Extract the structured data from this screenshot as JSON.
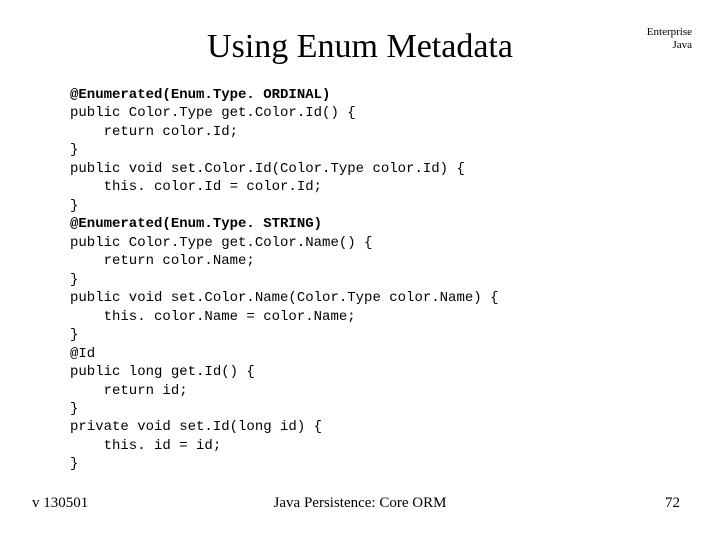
{
  "title": "Using Enum Metadata",
  "corner": {
    "line1": "Enterprise",
    "line2": "Java"
  },
  "code": {
    "l1": "@Enumerated(Enum.Type. ORDINAL)",
    "l2": "public Color.Type get.Color.Id() {",
    "l3": "    return color.Id;",
    "l4": "}",
    "l5": "public void set.Color.Id(Color.Type color.Id) {",
    "l6": "    this. color.Id = color.Id;",
    "l7": "}",
    "l8": "@Enumerated(Enum.Type. STRING)",
    "l9": "public Color.Type get.Color.Name() {",
    "l10": "    return color.Name;",
    "l11": "}",
    "l12": "public void set.Color.Name(Color.Type color.Name) {",
    "l13": "    this. color.Name = color.Name;",
    "l14": "}",
    "l15": "@Id",
    "l16": "public long get.Id() {",
    "l17": "    return id;",
    "l18": "}",
    "l19": "private void set.Id(long id) {",
    "l20": "    this. id = id;",
    "l21": "}"
  },
  "footer": {
    "left": "v 130501",
    "center": "Java Persistence: Core ORM",
    "right": "72"
  }
}
